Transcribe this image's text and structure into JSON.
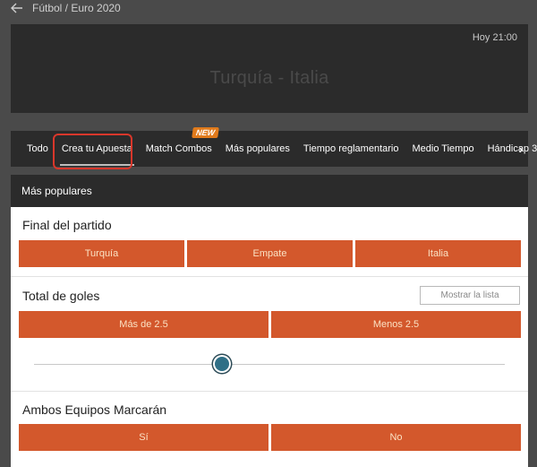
{
  "topbar": {
    "breadcrumb": "Fútbol / Euro 2020"
  },
  "match": {
    "time": "Hoy 21:00",
    "title": "Turquía - Italia"
  },
  "tabs": [
    {
      "label": "Todo"
    },
    {
      "label": "Crea tu Apuesta"
    },
    {
      "label": "Match Combos",
      "badge": "NEW"
    },
    {
      "label": "Más populares"
    },
    {
      "label": "Tiempo reglamentario"
    },
    {
      "label": "Medio Tiempo"
    },
    {
      "label": "Hándicap 3"
    }
  ],
  "section": {
    "title": "Más populares"
  },
  "markets": {
    "final": {
      "title": "Final del partido",
      "options": [
        "Turquía",
        "Empate",
        "Italia"
      ]
    },
    "goals": {
      "title": "Total de goles",
      "show_list": "Mostrar la lista",
      "options": [
        "Más de 2.5",
        "Menos 2.5"
      ]
    },
    "btts": {
      "title": "Ambos Equipos Marcarán",
      "options": [
        "Sí",
        "No"
      ]
    }
  },
  "colors": {
    "accent": "#d3582c",
    "badge": "#e07a1b",
    "highlight": "#d8372b",
    "slider": "#2f6f86"
  },
  "icons": {
    "back": "arrow-left-icon",
    "next": "chevron-right-icon"
  }
}
